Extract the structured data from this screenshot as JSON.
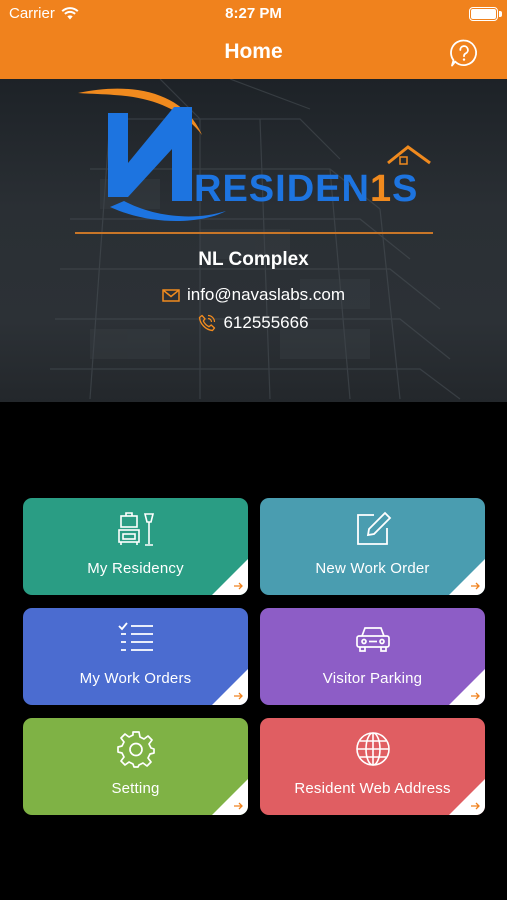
{
  "status_bar": {
    "carrier": "Carrier",
    "time": "8:27 PM"
  },
  "nav": {
    "title": "Home",
    "help_icon": "question-bubble-icon"
  },
  "banner": {
    "logo_text": "RESIDEN1S",
    "complex_name": "NL Complex",
    "email": "info@navaslabs.com",
    "phone": "612555666"
  },
  "tiles": [
    {
      "label": "My Residency",
      "icon": "furniture-icon",
      "color": "#2A9D84"
    },
    {
      "label": "New Work Order",
      "icon": "edit-icon",
      "color": "#4A9DB0"
    },
    {
      "label": "My Work Orders",
      "icon": "checklist-icon",
      "color": "#4B6CD0"
    },
    {
      "label": "Visitor Parking",
      "icon": "car-icon",
      "color": "#8D5DC6"
    },
    {
      "label": "Setting",
      "icon": "gear-icon",
      "color": "#7FB245"
    },
    {
      "label": "Resident Web Address",
      "icon": "globe-icon",
      "color": "#E05E62"
    }
  ],
  "colors": {
    "accent": "#F0821D",
    "background": "#000000",
    "logo_blue": "#1D74E0"
  }
}
